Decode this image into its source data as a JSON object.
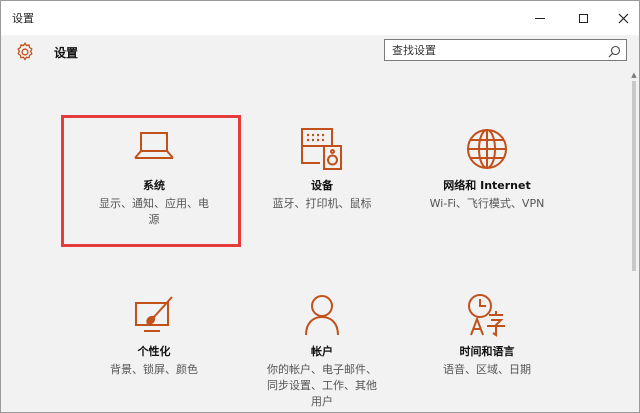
{
  "window": {
    "title": "设置"
  },
  "header": {
    "app_title": "设置",
    "search_placeholder": "查找设置"
  },
  "accent_color": "#c1501b",
  "highlight_color": "#e53b3b",
  "tiles": [
    {
      "title": "系统",
      "desc_lines": [
        "显示、通知、应用、电",
        "源"
      ],
      "icon": "laptop-icon",
      "highlighted": true
    },
    {
      "title": "设备",
      "desc_lines": [
        "蓝牙、打印机、鼠标"
      ],
      "icon": "keyboard-speaker-icon"
    },
    {
      "title": "网络和 Internet",
      "desc_lines": [
        "Wi-Fi、飞行模式、VPN"
      ],
      "icon": "globe-icon"
    },
    {
      "title": "个性化",
      "desc_lines": [
        "背景、锁屏、颜色"
      ],
      "icon": "paint-screen-icon"
    },
    {
      "title": "帐户",
      "desc_lines": [
        "你的帐户、电子邮件、",
        "同步设置、工作、其他",
        "用户"
      ],
      "icon": "person-icon"
    },
    {
      "title": "时间和语言",
      "desc_lines": [
        "语音、区域、日期"
      ],
      "icon": "clock-language-icon"
    }
  ]
}
